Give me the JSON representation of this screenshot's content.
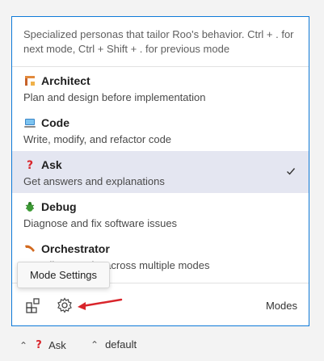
{
  "panel": {
    "description": "Specialized personas that tailor Roo's behavior. Ctrl + . for next mode, Ctrl + Shift + . for previous mode",
    "modes": [
      {
        "name": "Architect",
        "subtitle": "Plan and design before implementation",
        "icon": "architect-icon",
        "selected": false
      },
      {
        "name": "Code",
        "subtitle": "Write, modify, and refactor code",
        "icon": "laptop-icon",
        "selected": false
      },
      {
        "name": "Ask",
        "subtitle": "Get answers and explanations",
        "icon": "question-icon",
        "selected": true
      },
      {
        "name": "Debug",
        "subtitle": "Diagnose and fix software issues",
        "icon": "bug-icon",
        "selected": false
      },
      {
        "name": "Orchestrator",
        "subtitle": "Coordinate tasks across multiple modes",
        "icon": "boomerang-icon",
        "selected": false
      }
    ],
    "footer": {
      "modes_label": "Modes"
    }
  },
  "tooltip": {
    "text": "Mode Settings"
  },
  "statusbar": {
    "mode": "Ask",
    "profile": "default"
  },
  "colors": {
    "accent_border": "#0e7ad8",
    "selected_bg": "#e4e6f1",
    "arrow": "#d9252b"
  }
}
